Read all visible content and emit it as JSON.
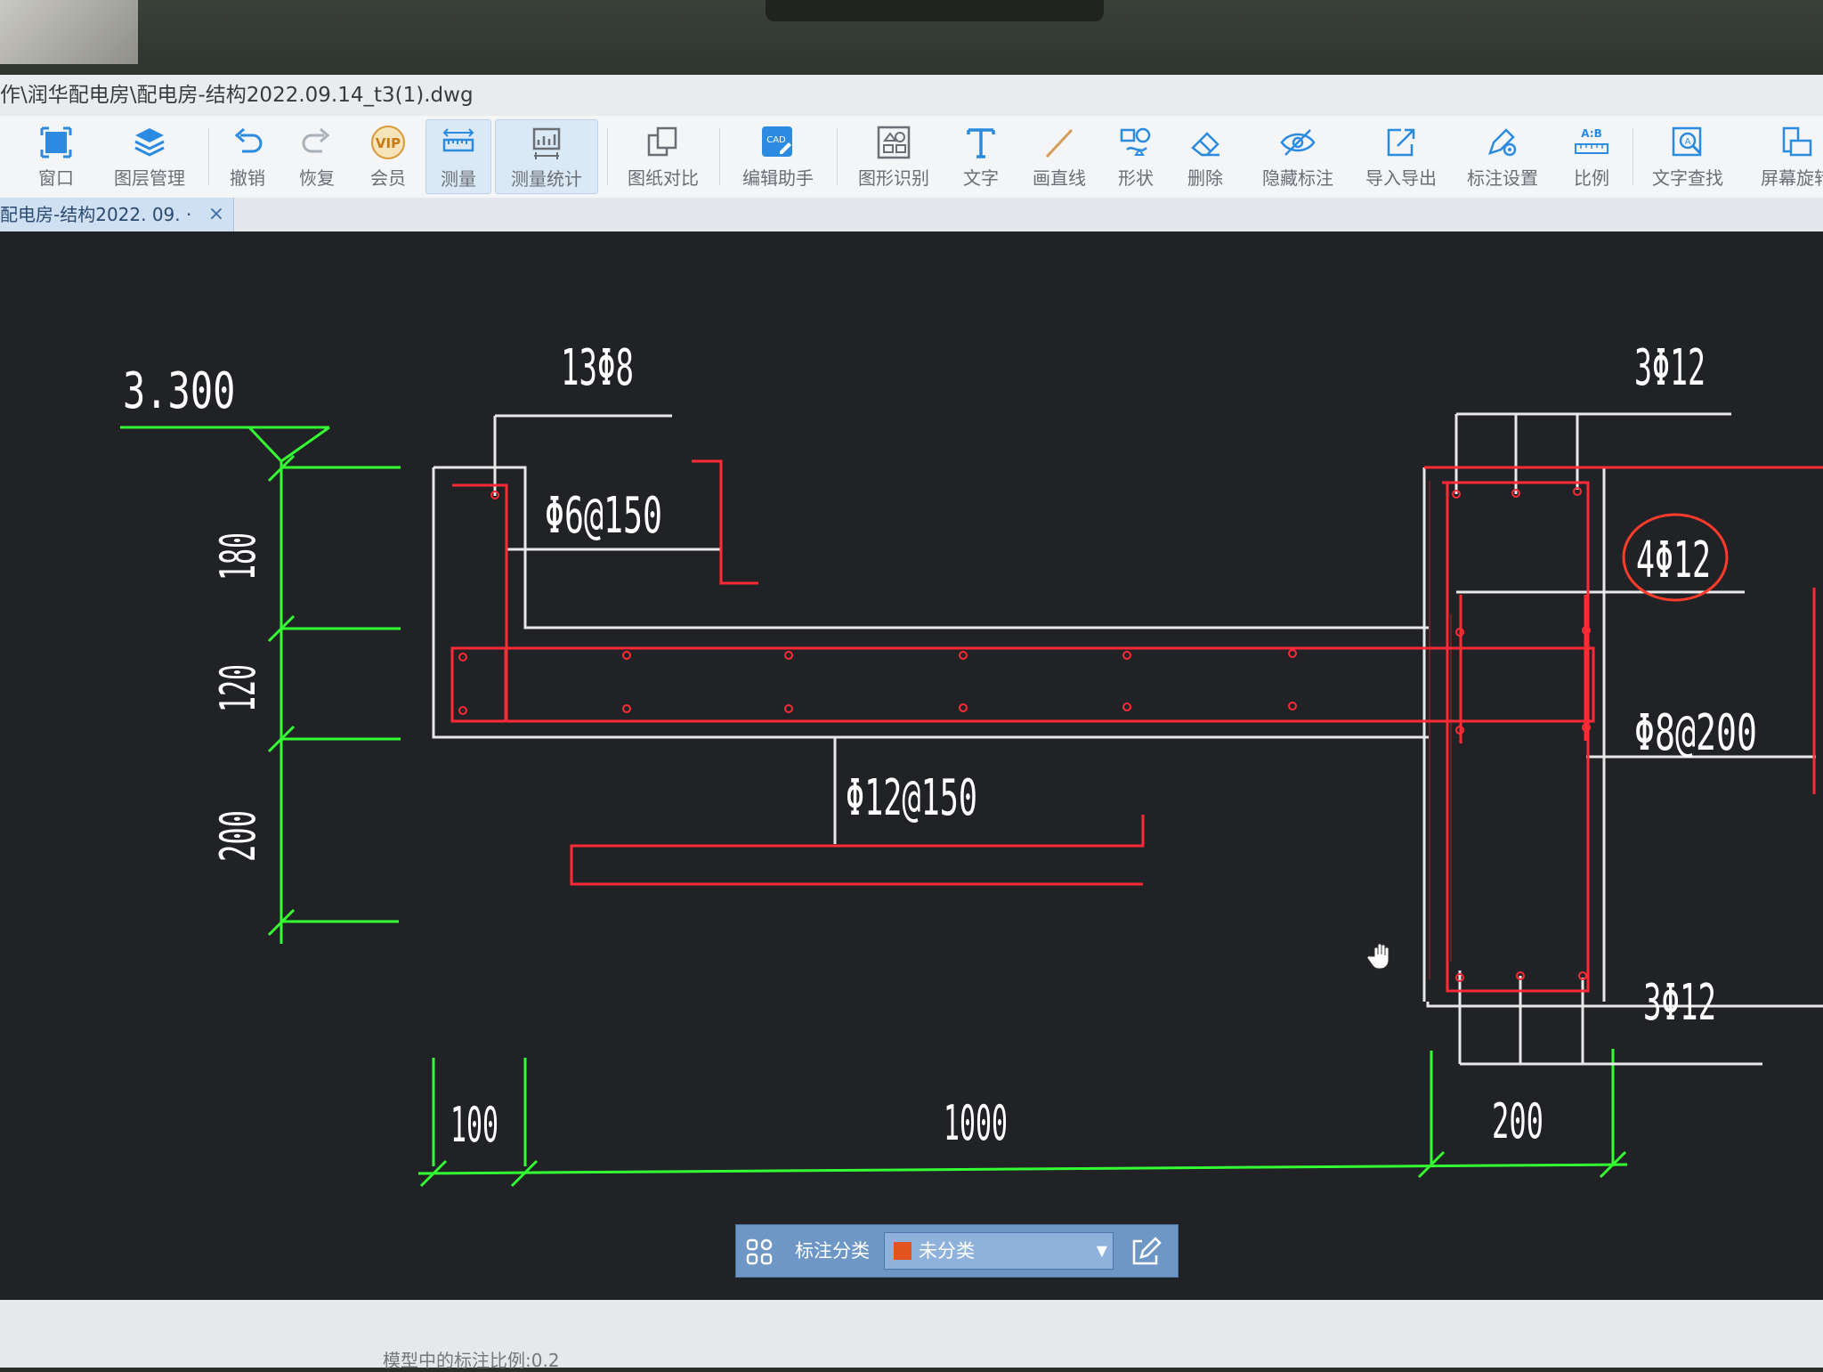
{
  "window": {
    "title": "作\\润华配电房\\配电房-结构2022.09.14_t3(1).dwg"
  },
  "toolbar": {
    "items": [
      {
        "id": "window",
        "label": "窗口",
        "icon": "window-icon"
      },
      {
        "id": "layers",
        "label": "图层管理",
        "icon": "layers-icon"
      },
      {
        "id": "undo",
        "label": "撤销",
        "icon": "undo-icon"
      },
      {
        "id": "redo",
        "label": "恢复",
        "icon": "redo-icon"
      },
      {
        "id": "vip",
        "label": "会员",
        "icon": "vip-icon"
      },
      {
        "id": "measure",
        "label": "测量",
        "icon": "ruler-icon"
      },
      {
        "id": "measure-stats",
        "label": "测量统计",
        "icon": "chart-icon"
      },
      {
        "id": "compare",
        "label": "图纸对比",
        "icon": "compare-icon"
      },
      {
        "id": "edit-assist",
        "label": "编辑助手",
        "icon": "cad-edit-icon"
      },
      {
        "id": "recognize",
        "label": "图形识别",
        "icon": "shape-recognize-icon"
      },
      {
        "id": "text",
        "label": "文字",
        "icon": "text-icon"
      },
      {
        "id": "line",
        "label": "画直线",
        "icon": "line-icon"
      },
      {
        "id": "shape",
        "label": "形状",
        "icon": "shape-icon"
      },
      {
        "id": "delete",
        "label": "删除",
        "icon": "eraser-icon"
      },
      {
        "id": "hide-annot",
        "label": "隐藏标注",
        "icon": "eye-icon"
      },
      {
        "id": "import-export",
        "label": "导入导出",
        "icon": "export-icon"
      },
      {
        "id": "annot-settings",
        "label": "标注设置",
        "icon": "annotation-settings-icon"
      },
      {
        "id": "scale",
        "label": "比例",
        "icon": "scale-icon"
      },
      {
        "id": "text-search",
        "label": "文字查找",
        "icon": "text-search-icon"
      },
      {
        "id": "rotate",
        "label": "屏幕旋转",
        "icon": "rotate-screen-icon"
      }
    ]
  },
  "tab": {
    "label": "配电房-结构2022. 09. ·",
    "close": "×"
  },
  "drawing": {
    "elevation": "3.300",
    "top_bar_spec": "13Φ8",
    "stirrup_spec": "Φ6@150",
    "bottom_bar_spec": "Φ12@150",
    "beam_top": "3Φ12",
    "beam_side": "4Φ12",
    "beam_stirrup": "Φ8@200",
    "beam_bottom": "3Φ12",
    "dim_vertical": [
      "180",
      "120",
      "200"
    ],
    "dim_horizontal": [
      "100",
      "1000",
      "200"
    ],
    "colors": {
      "dimension": "#33ff33",
      "rebar": "#ff2a35",
      "outline": "#e8e8e8",
      "text": "#ffffff",
      "highlight": "#ff3b2a",
      "background": "#202226"
    }
  },
  "annotation_bar": {
    "label": "标注分类",
    "selected": "未分类"
  },
  "status": {
    "text": "模型中的标注比例:0.2"
  }
}
